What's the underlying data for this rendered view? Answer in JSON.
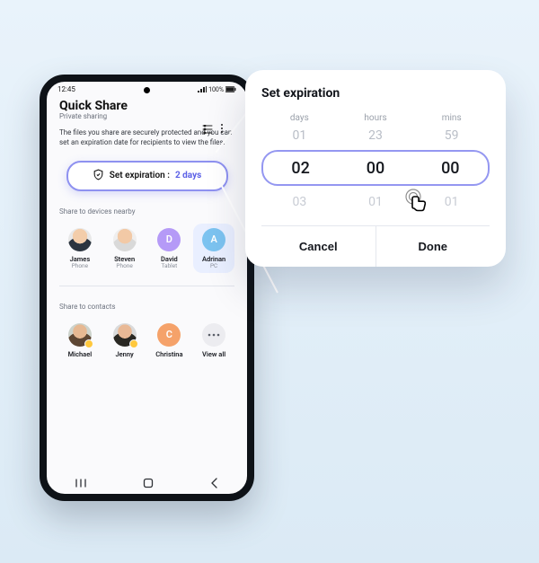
{
  "status": {
    "time": "12:45",
    "signal_icon": "signal",
    "battery_text": "100%"
  },
  "header": {
    "title": "Quick Share",
    "subtitle": "Private sharing",
    "list_icon": "list-filter",
    "more_icon": "more-vertical"
  },
  "description": "The files you share are securely protected and you can set an expiration date for recipients to view the files.",
  "expiration": {
    "icon": "shield",
    "label": "Set expiration : ",
    "value": "2 days"
  },
  "sectionNearby": "Share to devices nearby",
  "devices": [
    {
      "name": "James",
      "sub": "Phone",
      "kind": "photo",
      "style": "av-james",
      "selected": false
    },
    {
      "name": "Steven",
      "sub": "Phone",
      "kind": "photo",
      "style": "av-steven",
      "selected": false
    },
    {
      "name": "David",
      "sub": "Tablet",
      "kind": "letter",
      "letter": "D",
      "color": "#b59af7",
      "selected": false
    },
    {
      "name": "Adrinan",
      "sub": "PC",
      "kind": "letter",
      "letter": "A",
      "color": "#7cc3f0",
      "selected": true
    }
  ],
  "sectionContacts": "Share to contacts",
  "contacts": [
    {
      "name": "Michael",
      "kind": "photo",
      "style": "av-michael",
      "badged": true
    },
    {
      "name": "Jenny",
      "kind": "photo",
      "style": "av-jenny",
      "badged": true
    },
    {
      "name": "Christina",
      "kind": "letter",
      "letter": "C",
      "color": "#f5a26a",
      "badged": false
    },
    {
      "name": "View all",
      "kind": "dots"
    }
  ],
  "nav": {
    "recents": "recents",
    "home": "home",
    "back": "back"
  },
  "picker": {
    "title": "Set expiration",
    "labels": {
      "days": "days",
      "hours": "hours",
      "mins": "mins"
    },
    "prev": {
      "days": "01",
      "hours": "23",
      "mins": "59"
    },
    "curr": {
      "days": "02",
      "hours": "00",
      "mins": "00"
    },
    "next": {
      "days": "03",
      "hours": "01",
      "mins": "01"
    },
    "cancel": "Cancel",
    "done": "Done"
  }
}
